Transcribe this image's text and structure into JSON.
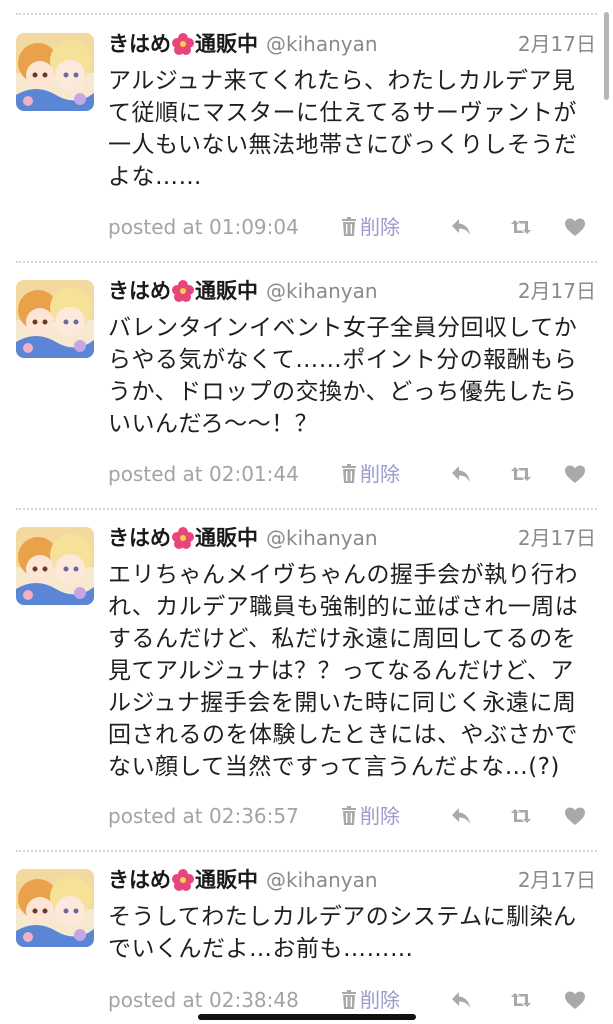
{
  "tweets": [
    {
      "display_name_before": "きはめ",
      "display_name_after": "通販中",
      "handle": "@kihanyan",
      "date": "2月17日",
      "lines": [
        "アルジュナ来てくれたら、わたしカルデア見",
        "て従順にマスターに仕えてるサーヴァントが",
        "一人もいない無法地帯さにびっくりしそうだ",
        "よな……"
      ],
      "posted": "posted at 01:09:04",
      "delete_label": "削除"
    },
    {
      "display_name_before": "きはめ",
      "display_name_after": "通販中",
      "handle": "@kihanyan",
      "date": "2月17日",
      "lines": [
        "バレンタインイベント女子全員分回収してか",
        "らやる気がなくて……ポイント分の報酬もら",
        "うか、ドロップの交換か、どっち優先したら",
        "いいんだろ〜〜！？"
      ],
      "posted": "posted at 02:01:44",
      "delete_label": "削除"
    },
    {
      "display_name_before": "きはめ",
      "display_name_after": "通販中",
      "handle": "@kihanyan",
      "date": "2月17日",
      "lines": [
        "エリちゃんメイヴちゃんの握手会が執り行わ",
        "れ、カルデア職員も強制的に並ばされ一周は",
        "するんだけど、私だけ永遠に周回してるのを",
        "見てアルジュナは？？ってなるんだけど、ア",
        "ルジュナ握手会を開いた時に同じく永遠に周",
        "回されるのを体験したときには、やぶさかで",
        "ない顔して当然ですって言うんだよな…(?)"
      ],
      "posted": "posted at 02:36:57",
      "delete_label": "削除"
    },
    {
      "display_name_before": "きはめ",
      "display_name_after": "通販中",
      "handle": "@kihanyan",
      "date": "2月17日",
      "lines": [
        "そうしてわたしカルデアのシステムに馴染ん",
        "でいくんだよ…お前も………"
      ],
      "posted": "posted at 02:38:48",
      "delete_label": "削除"
    }
  ],
  "icons": {
    "avatar": "avatar-illustration",
    "flower": "hibiscus-emoji",
    "delete": "trash-icon",
    "reply": "reply-icon",
    "retweet": "retweet-icon",
    "like": "heart-icon"
  },
  "colors": {
    "text": "#1f1f1f",
    "muted": "#8a8a8a",
    "delete": "#9a9acd",
    "icon": "#a9a9a9",
    "flower": "#e8457d"
  }
}
